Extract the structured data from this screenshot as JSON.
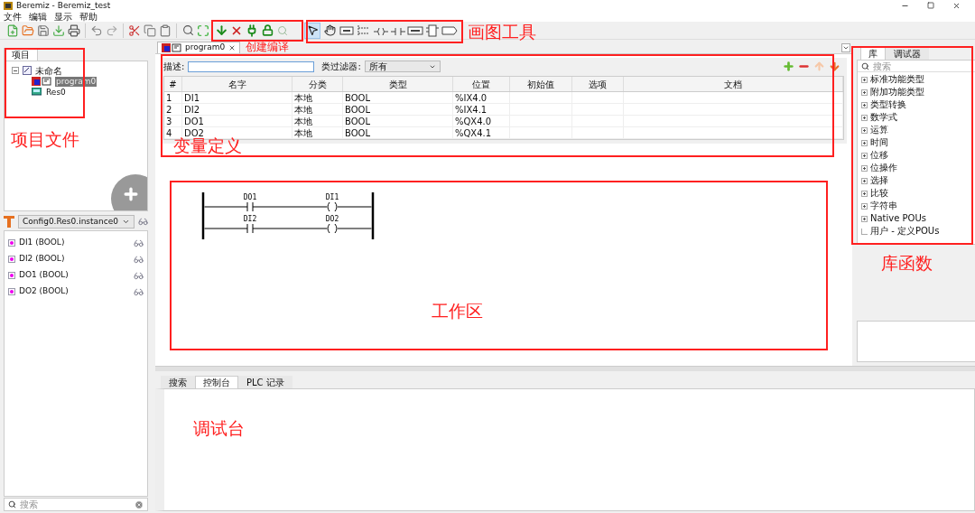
{
  "window": {
    "title": "Beremiz - Beremiz_test"
  },
  "menu": [
    "文件",
    "编辑",
    "显示",
    "帮助"
  ],
  "drawing_tools": [
    {
      "kind": "pointer",
      "selected": true
    },
    {
      "kind": "hand",
      "selected": false
    },
    {
      "kind": "comment",
      "selected": false
    },
    {
      "kind": "rail",
      "selected": false
    },
    {
      "kind": "coil",
      "selected": false
    },
    {
      "kind": "contact",
      "selected": false
    },
    {
      "kind": "variable",
      "selected": false
    },
    {
      "kind": "block",
      "selected": false
    },
    {
      "kind": "connector",
      "selected": false
    }
  ],
  "project_panel": {
    "tabs": [
      {
        "label": "项目",
        "selected": true
      }
    ],
    "tree": [
      {
        "label": "未命名",
        "kind": "project",
        "expanded": true,
        "selected": false,
        "children": [
          {
            "label": "program0",
            "kind": "program",
            "selected": true
          },
          {
            "label": "Res0",
            "kind": "resource",
            "selected": false
          }
        ]
      }
    ],
    "instance": "Config0.Res0.instance0",
    "variables": [
      "DI1 (BOOL)",
      "DI2 (BOOL)",
      "DO1 (BOOL)",
      "DO2 (BOOL)"
    ],
    "search": {
      "placeholder": "搜索"
    }
  },
  "editor": {
    "tabs": [
      {
        "label": "program0",
        "selected": true
      }
    ],
    "description_label": "描述:",
    "filter_label": "类过滤器:",
    "filter_value": "所有",
    "table": {
      "columns": [
        "#",
        "名字",
        "分类",
        "类型",
        "位置",
        "初始值",
        "选项",
        "文档"
      ],
      "rows": [
        [
          "1",
          "DI1",
          "本地",
          "BOOL",
          "%IX4.0",
          "",
          "",
          ""
        ],
        [
          "2",
          "DI2",
          "本地",
          "BOOL",
          "%IX4.1",
          "",
          "",
          ""
        ],
        [
          "3",
          "DO1",
          "本地",
          "BOOL",
          "%QX4.0",
          "",
          "",
          ""
        ],
        [
          "4",
          "DO2",
          "本地",
          "BOOL",
          "%QX4.1",
          "",
          "",
          ""
        ]
      ]
    },
    "ladder": [
      {
        "contact": "DO1",
        "coil": "DI1"
      },
      {
        "contact": "DI2",
        "coil": "DO2"
      }
    ]
  },
  "library": {
    "tabs": [
      {
        "label": "库",
        "selected": true
      },
      {
        "label": "调试器",
        "selected": false
      }
    ],
    "search": {
      "placeholder": "搜索"
    },
    "items": [
      {
        "label": "标准功能类型",
        "expandable": true
      },
      {
        "label": "附加功能类型",
        "expandable": true
      },
      {
        "label": "类型转换",
        "expandable": true
      },
      {
        "label": "数学式",
        "expandable": true
      },
      {
        "label": "运算",
        "expandable": true
      },
      {
        "label": "时间",
        "expandable": true
      },
      {
        "label": "位移",
        "expandable": true
      },
      {
        "label": "位操作",
        "expandable": true
      },
      {
        "label": "选择",
        "expandable": true
      },
      {
        "label": "比较",
        "expandable": true
      },
      {
        "label": "字符串",
        "expandable": true
      },
      {
        "label": "Native POUs",
        "expandable": true
      },
      {
        "label": "用户 - 定义POUs",
        "expandable": false
      }
    ]
  },
  "console": {
    "tabs": [
      {
        "label": "搜索",
        "selected": false
      },
      {
        "label": "控制台",
        "selected": true
      },
      {
        "label": "PLC 记录",
        "selected": false
      }
    ]
  },
  "annotations": [
    {
      "label": "创建编译",
      "kind": "build"
    },
    {
      "label": "画图工具",
      "kind": "draw"
    },
    {
      "label": "项目文件",
      "kind": "project"
    },
    {
      "label": "变量定义",
      "kind": "vars"
    },
    {
      "label": "工作区",
      "kind": "work"
    },
    {
      "label": "库函数",
      "kind": "lib"
    },
    {
      "label": "调试台",
      "kind": "console"
    }
  ]
}
